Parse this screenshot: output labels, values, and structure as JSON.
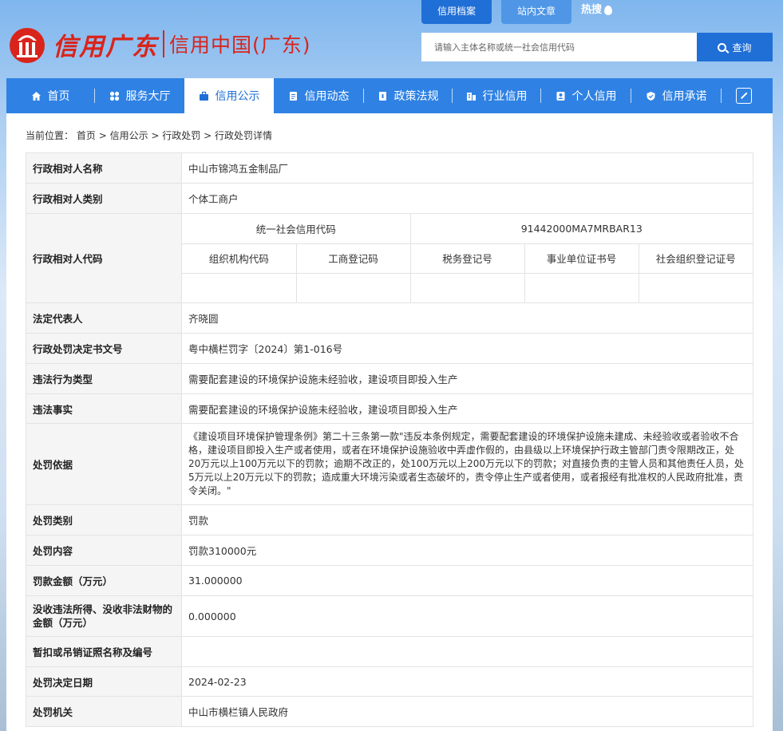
{
  "header": {
    "logo_text": "信用广东",
    "logo_sub": "信用中国(广东)",
    "top_tabs": [
      {
        "label": "信用档案",
        "active": true
      },
      {
        "label": "站内文章",
        "active": false
      }
    ],
    "hot_label": "热搜",
    "search": {
      "placeholder": "请输入主体名称或统一社会信用代码",
      "button_label": "查询"
    }
  },
  "nav": {
    "items": [
      {
        "label": "首页",
        "icon": "home-icon"
      },
      {
        "label": "服务大厅",
        "icon": "grid-icon"
      },
      {
        "label": "信用公示",
        "icon": "briefcase-icon",
        "active": true
      },
      {
        "label": "信用动态",
        "icon": "document-icon"
      },
      {
        "label": "政策法规",
        "icon": "book-icon"
      },
      {
        "label": "行业信用",
        "icon": "building-icon"
      },
      {
        "label": "个人信用",
        "icon": "id-card-icon"
      },
      {
        "label": "信用承诺",
        "icon": "shield-icon"
      }
    ],
    "colors": {
      "bar": "#2f82e4",
      "active_text": "#1f6fd6"
    }
  },
  "breadcrumb": {
    "prefix": "当前位置：",
    "items": [
      "首页",
      "信用公示",
      "行政处罚",
      "行政处罚详情"
    ],
    "separator": " > "
  },
  "detail": {
    "name_label": "行政相对人名称",
    "name_value": "中山市锦鸿五金制品厂",
    "type_label": "行政相对人类别",
    "type_value": "个体工商户",
    "code_label": "行政相对人代码",
    "code": {
      "uscc_label": "统一社会信用代码",
      "uscc_value": "91442000MA7MRBAR13",
      "headers": [
        "组织机构代码",
        "工商登记码",
        "税务登记号",
        "事业单位证书号",
        "社会组织登记证号"
      ],
      "values": [
        "",
        "",
        "",
        "",
        ""
      ]
    },
    "legal_rep_label": "法定代表人",
    "legal_rep_value": "齐晓圆",
    "doc_no_label": "行政处罚决定书文号",
    "doc_no_value": "粤中横栏罚字〔2024〕第1-016号",
    "violation_type_label": "违法行为类型",
    "violation_type_value": "需要配套建设的环境保护设施未经验收，建设项目即投入生产",
    "violation_fact_label": "违法事实",
    "violation_fact_value": "需要配套建设的环境保护设施未经验收，建设项目即投入生产",
    "basis_label": "处罚依据",
    "basis_value": "《建设项目环境保护管理条例》第二十三条第一款\"违反本条例规定，需要配套建设的环境保护设施未建成、未经验收或者验收不合格，建设项目即投入生产或者使用，或者在环境保护设施验收中弄虚作假的，由县级以上环境保护行政主管部门责令限期改正，处20万元以上100万元以下的罚款；逾期不改正的，处100万元以上200万元以下的罚款；对直接负责的主管人员和其他责任人员，处5万元以上20万元以下的罚款；造成重大环境污染或者生态破坏的，责令停止生产或者使用，或者报经有批准权的人民政府批准，责令关闭。\"",
    "category_label": "处罚类别",
    "category_value": "罚款",
    "content_label": "处罚内容",
    "content_value": "罚款310000元",
    "fine_label": "罚款金额（万元）",
    "fine_value": "31.000000",
    "confiscation_label": "没收违法所得、没收非法财物的金额（万元）",
    "confiscation_value": "0.000000",
    "license_label": "暂扣或吊销证照名称及编号",
    "license_value": "",
    "date_label": "处罚决定日期",
    "date_value": "2024-02-23",
    "authority_label": "处罚机关",
    "authority_value": "中山市横栏镇人民政府"
  }
}
